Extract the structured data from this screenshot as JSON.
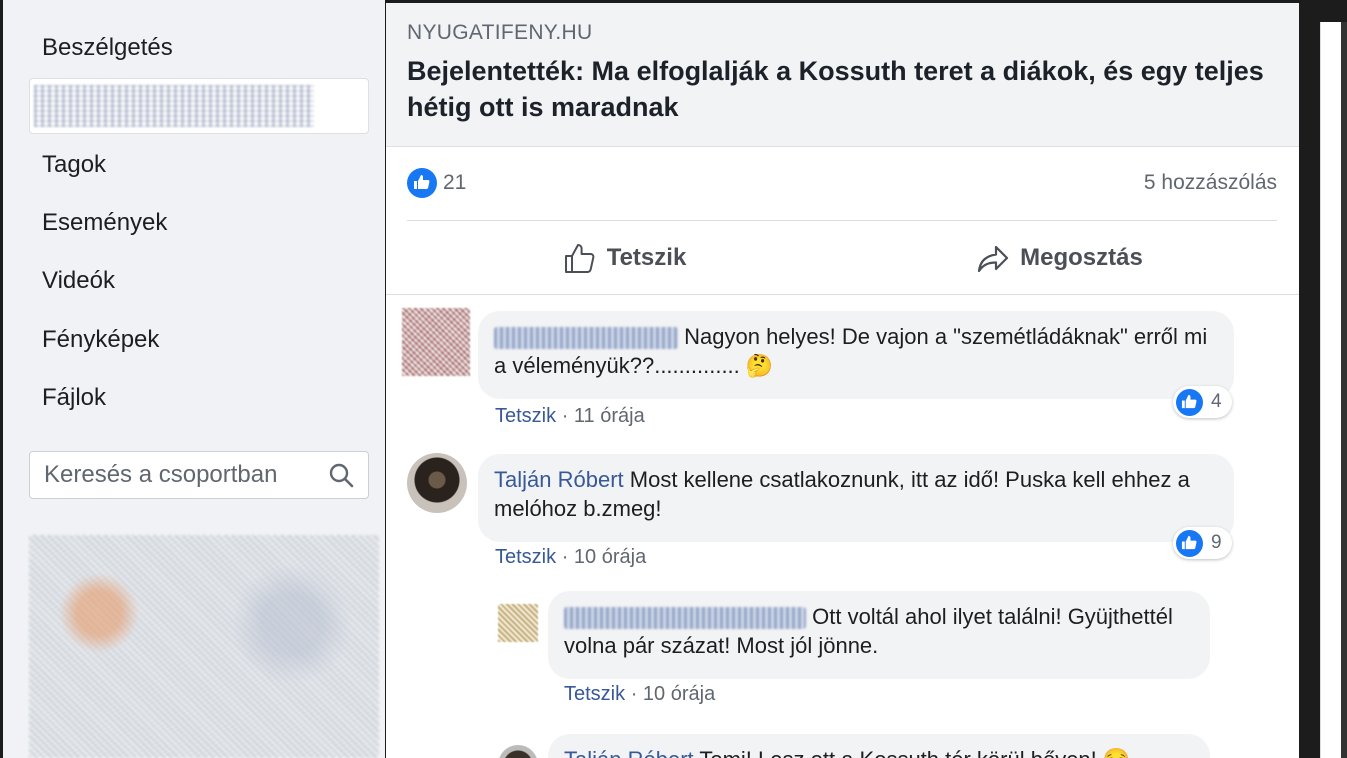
{
  "sidebar": {
    "items": [
      {
        "label": "Beszélgetés"
      },
      {
        "label": "Tagok"
      },
      {
        "label": "Események"
      },
      {
        "label": "Videók"
      },
      {
        "label": "Fényképek"
      },
      {
        "label": "Fájlok"
      }
    ],
    "search_placeholder": "Keresés a csoportban"
  },
  "post": {
    "source": "NYUGATIFENY.HU",
    "headline": "Bejelentették: Ma elfoglalják a Kossuth teret a diákok, és egy teljes hétig ott is maradnak",
    "like_count": "21",
    "comment_count": "5 hozzászólás",
    "like_action": "Tetszik",
    "share_action": "Megosztás"
  },
  "comments": [
    {
      "text": "Nagyon helyes! De vajon a \"szemétládáknak\" erről mi a véleményük??.............. 🤔",
      "like_label": "Tetszik",
      "time": "11 órája",
      "reactions": "4"
    },
    {
      "author": "Talján Róbert",
      "text": "Most kellene csatlakoznunk, itt az idő! Puska kell ehhez a melóhoz b.zmeg!",
      "like_label": "Tetszik",
      "time": "10 órája",
      "reactions": "9"
    },
    {
      "text": "Ott voltál ahol ilyet találni! Gyüjthettél volna pár százat! Most jól jönne.",
      "like_label": "Tetszik",
      "time": "10 órája"
    },
    {
      "author": "Talján Róbert",
      "text": "Tomi! Lesz ott a Kossuth tér körül bőven! 😏"
    }
  ],
  "colors": {
    "accent": "#1877f2",
    "link": "#385898",
    "sidebar_bg": "#f0f2f5"
  }
}
